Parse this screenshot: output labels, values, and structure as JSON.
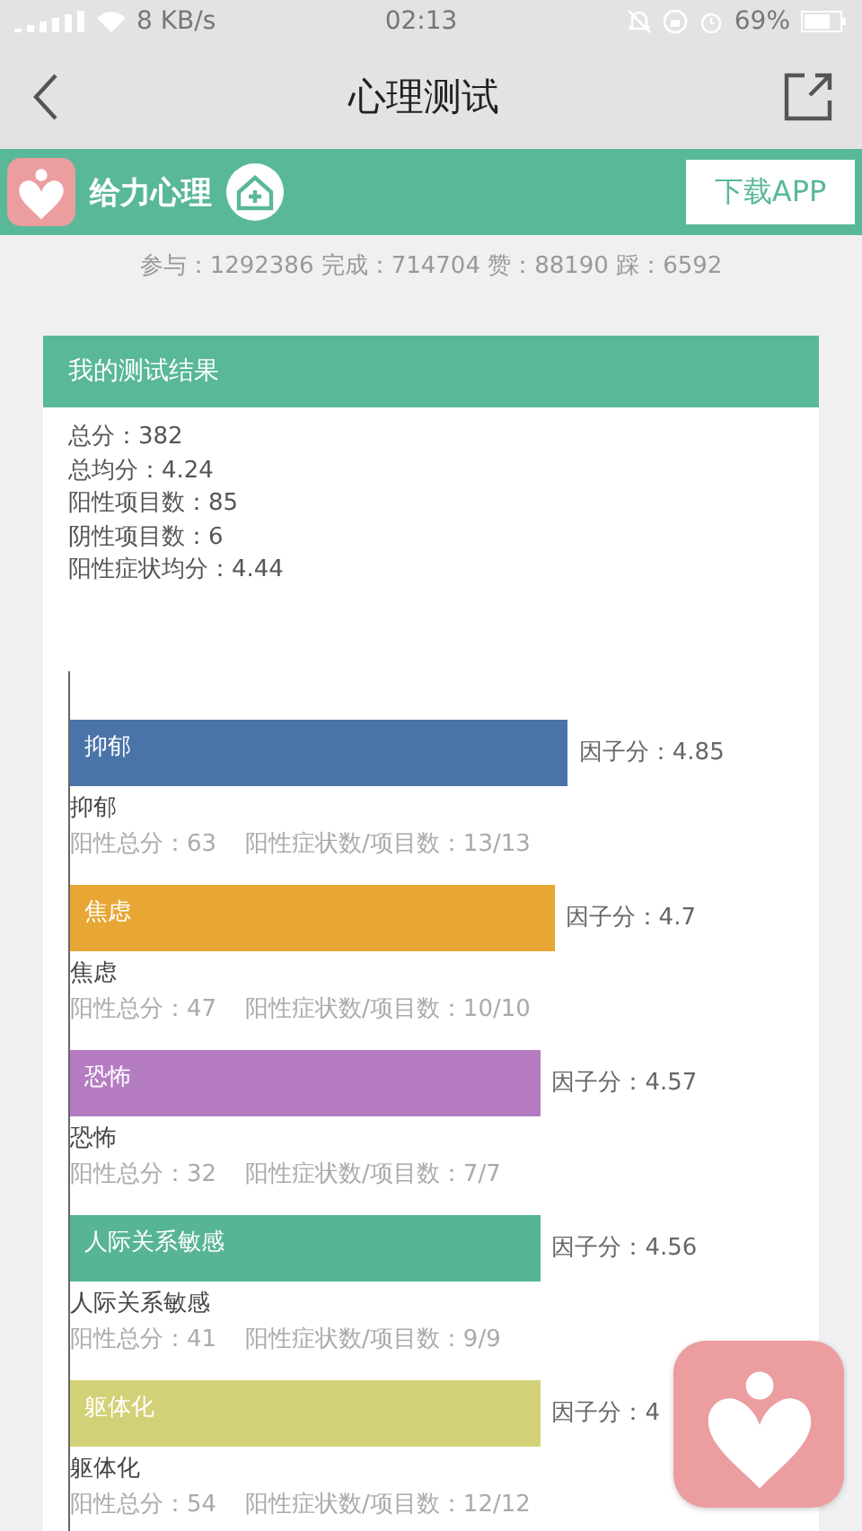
{
  "status_bar": {
    "speed": "8 KB/s",
    "time": "02:13",
    "battery": "69%"
  },
  "nav": {
    "title": "心理测试"
  },
  "banner": {
    "brand": "给力心理",
    "download": "下载APP"
  },
  "stats": "参与：1292386 完成：714704 赞：88190 踩：6592",
  "result": {
    "title": "我的测试结果",
    "summary": [
      "总分：382",
      "总均分：4.24",
      "阳性项目数：85",
      "阴性项目数：6",
      "阳性症状均分：4.44"
    ],
    "factors": [
      {
        "name": "抑郁",
        "color": "#4a74a8",
        "level": 0.73,
        "score": "因子分：4.85",
        "caption": "抑郁",
        "total": "阳性总分：63",
        "ratio": "阳性症状数/项目数：13/13"
      },
      {
        "name": "焦虑",
        "color": "#e8a735",
        "level": 0.71,
        "score": "因子分：4.7",
        "caption": "焦虑",
        "total": "阳性总分：47",
        "ratio": "阳性症状数/项目数：10/10"
      },
      {
        "name": "恐怖",
        "color": "#b57cc2",
        "level": 0.69,
        "score": "因子分：4.57",
        "caption": "恐怖",
        "total": "阳性总分：32",
        "ratio": "阳性症状数/项目数：7/7"
      },
      {
        "name": "人际关系敏感",
        "color": "#58b593",
        "level": 0.69,
        "score": "因子分：4.56",
        "caption": "人际关系敏感",
        "total": "阳性总分：41",
        "ratio": "阳性症状数/项目数：9/9"
      },
      {
        "name": "躯体化",
        "color": "#d3d177",
        "level": 0.69,
        "score": "因子分：4",
        "caption": "躯体化",
        "total": "阳性总分：54",
        "ratio": "阳性症状数/项目数：12/12"
      }
    ]
  }
}
